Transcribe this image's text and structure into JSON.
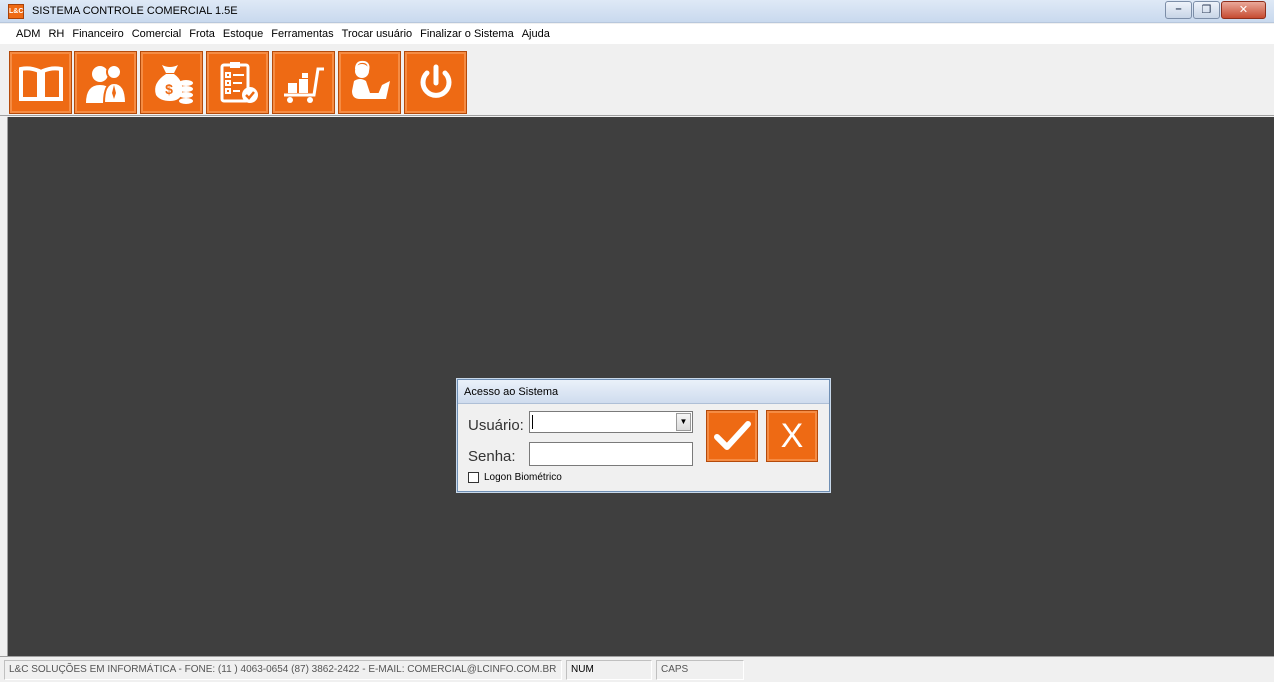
{
  "window": {
    "title": "SISTEMA CONTROLE COMERCIAL 1.5E",
    "app_icon_text": "L&C"
  },
  "menu": [
    {
      "label": "ADM"
    },
    {
      "label": "RH"
    },
    {
      "label": "Financeiro"
    },
    {
      "label": "Comercial"
    },
    {
      "label": "Frota"
    },
    {
      "label": "Estoque"
    },
    {
      "label": "Ferramentas"
    },
    {
      "label": "Trocar usuário"
    },
    {
      "label": "Finalizar o Sistema"
    },
    {
      "label": "Ajuda"
    }
  ],
  "toolbar": [
    {
      "icon": "book-icon"
    },
    {
      "icon": "users-icon"
    },
    {
      "icon": "money-bag-icon"
    },
    {
      "icon": "checklist-icon"
    },
    {
      "icon": "cart-boxes-icon"
    },
    {
      "icon": "desk-operator-icon"
    },
    {
      "icon": "power-icon"
    }
  ],
  "login": {
    "title": "Acesso ao Sistema",
    "user_label": "Usuário:",
    "user_value": "",
    "password_label": "Senha:",
    "password_value": "",
    "biometric_label": "Logon Biométrico",
    "biometric_checked": false,
    "confirm_icon": "check-icon",
    "cancel_label": "X"
  },
  "status": {
    "company": "L&C SOLUÇÕES EM INFORMÁTICA - FONE: (11 ) 4063-0654  (87) 3862-2422 - E-MAIL: COMERCIAL@LCINFO.COM.BR",
    "num": "NUM",
    "caps": "CAPS"
  },
  "colors": {
    "accent": "#ee6a14",
    "workspace": "#3f3f3f"
  }
}
